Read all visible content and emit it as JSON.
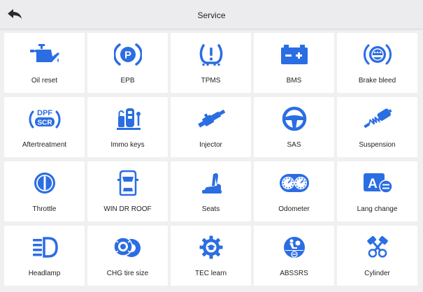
{
  "header": {
    "title": "Service",
    "back_icon": "back-arrow-icon"
  },
  "colors": {
    "accent": "#2b6de3",
    "background": "#f0f0f2",
    "tile": "#ffffff"
  },
  "functions": [
    {
      "label": "Oil reset",
      "icon": "oil-can-icon"
    },
    {
      "label": "EPB",
      "icon": "parking-brake-icon"
    },
    {
      "label": "TPMS",
      "icon": "tire-pressure-warning-icon"
    },
    {
      "label": "BMS",
      "icon": "battery-icon"
    },
    {
      "label": "Brake bleed",
      "icon": "brake-disc-icon"
    },
    {
      "label": "Aftertreatment",
      "icon": "dpf-scr-icon"
    },
    {
      "label": "Immo keys",
      "icon": "immobilizer-key-icon"
    },
    {
      "label": "Injector",
      "icon": "fuel-injector-icon"
    },
    {
      "label": "SAS",
      "icon": "steering-wheel-icon"
    },
    {
      "label": "Suspension",
      "icon": "shock-absorber-icon"
    },
    {
      "label": "Throttle",
      "icon": "throttle-body-icon"
    },
    {
      "label": "WIN DR ROOF",
      "icon": "car-top-view-icon"
    },
    {
      "label": "Seats",
      "icon": "car-seat-icon"
    },
    {
      "label": "Odometer",
      "icon": "instrument-cluster-icon"
    },
    {
      "label": "Lang change",
      "icon": "language-change-icon"
    },
    {
      "label": "Headlamp",
      "icon": "headlamp-icon"
    },
    {
      "label": "CHG tire size",
      "icon": "tire-size-icon"
    },
    {
      "label": "TEC learn",
      "icon": "gear-learn-icon"
    },
    {
      "label": "ABSSRS",
      "icon": "abs-srs-icon"
    },
    {
      "label": "Cylinder",
      "icon": "cylinder-piston-icon"
    }
  ]
}
